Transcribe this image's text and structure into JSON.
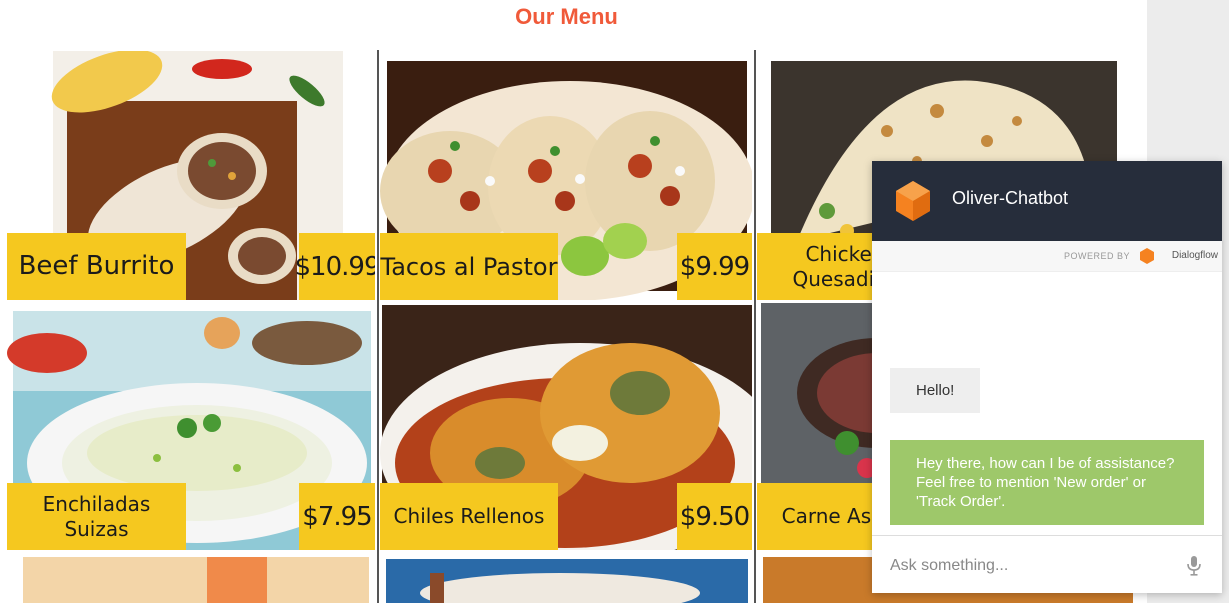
{
  "page": {
    "title": "Our Menu"
  },
  "menu_items": [
    {
      "name": "Beef Burrito",
      "price": "$10.99"
    },
    {
      "name": "Tacos al Pastor",
      "price": "$9.99"
    },
    {
      "name": "Chicken\nQuesadilla",
      "price": ""
    },
    {
      "name": "Enchiladas\nSuizas",
      "price": "$7.95"
    },
    {
      "name": "Chiles Rellenos",
      "price": "$9.50"
    },
    {
      "name": "Carne Asada",
      "price": ""
    }
  ],
  "chatbot": {
    "title": "Oliver-Chatbot",
    "powered_by": "POWERED BY",
    "brand": "Dialogflow",
    "messages": [
      {
        "from": "user",
        "text": "Hello!"
      },
      {
        "from": "bot",
        "text": "Hey there, how can I be of assistance? Feel free to mention 'New order' or 'Track Order'."
      }
    ],
    "input_placeholder": "Ask something...",
    "input_value": ""
  },
  "colors": {
    "title": "#f05a3a",
    "label_bg": "#f5c81f",
    "chat_header": "#262d3b",
    "bot_bubble": "#9ec86a",
    "user_bubble": "#eeeeee",
    "dialogflow_orange": "#f58220"
  }
}
